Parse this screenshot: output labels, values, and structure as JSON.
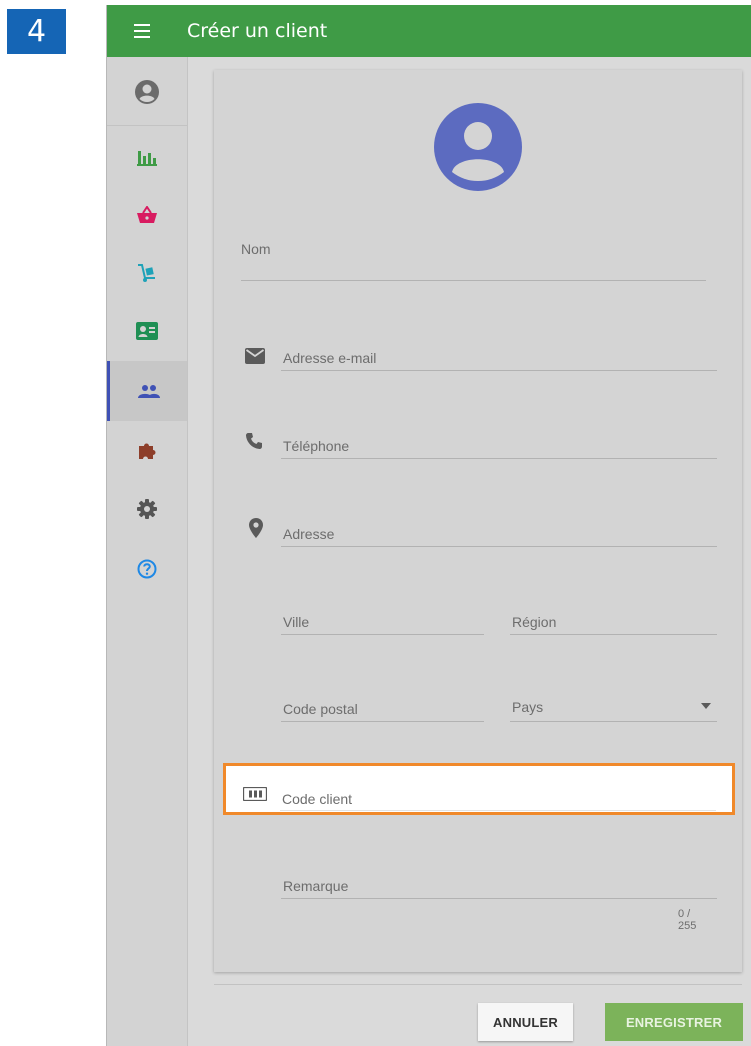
{
  "step_number": "4",
  "header": {
    "title": "Créer un client",
    "menu_icon": "hamburger-icon"
  },
  "sidebar": {
    "items": [
      {
        "icon": "account-circle-icon",
        "color": "#6b6b6b"
      },
      {
        "icon": "bar-chart-icon",
        "color": "#3f9b46"
      },
      {
        "icon": "shopping-basket-icon",
        "color": "#d81b60"
      },
      {
        "icon": "hand-truck-icon",
        "color": "#1fa2b8"
      },
      {
        "icon": "contact-card-icon",
        "color": "#1f8f54"
      },
      {
        "icon": "people-icon",
        "color": "#3f51b5",
        "active": true
      },
      {
        "icon": "puzzle-icon",
        "color": "#8d3e2a"
      },
      {
        "icon": "gear-icon",
        "color": "#555555"
      },
      {
        "icon": "help-circle-icon",
        "color": "#1e88e5"
      }
    ]
  },
  "form": {
    "avatar_icon": "account-circle-icon",
    "avatar_color": "#5c6bc0",
    "name_label": "Nom",
    "email_label": "Adresse e-mail",
    "phone_label": "Téléphone",
    "address_label": "Adresse",
    "city_label": "Ville",
    "region_label": "Région",
    "postal_label": "Code postal",
    "country_label": "Pays",
    "client_code_label": "Code client",
    "note_label": "Remarque",
    "note_counter": "0 / 255"
  },
  "actions": {
    "cancel_label": "ANNULER",
    "save_label": "ENREGISTRER"
  },
  "colors": {
    "topbar": "#3f9b46",
    "highlight": "#f0892a",
    "save": "#7cb35a"
  }
}
